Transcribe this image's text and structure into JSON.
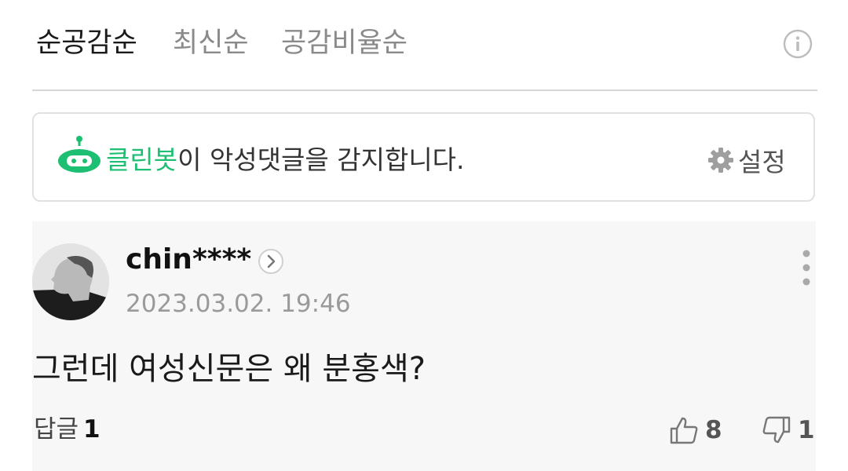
{
  "sort_tabs": [
    {
      "label": "순공감순",
      "active": true
    },
    {
      "label": "최신순",
      "active": false
    },
    {
      "label": "공감비율순",
      "active": false
    }
  ],
  "info_icon": "info-circle-icon",
  "cleanbot": {
    "name": "클린봇",
    "message": "이 악성댓글을 감지합니다.",
    "settings_label": "설정",
    "accent_color": "#1dbf73"
  },
  "comment": {
    "username": "chin****",
    "timestamp": "2023.03.02. 19:46",
    "body": "그런데 여성신문은 왜 분홍색?",
    "reply_label": "답글",
    "reply_count": "1",
    "likes": "8",
    "dislikes": "1"
  }
}
